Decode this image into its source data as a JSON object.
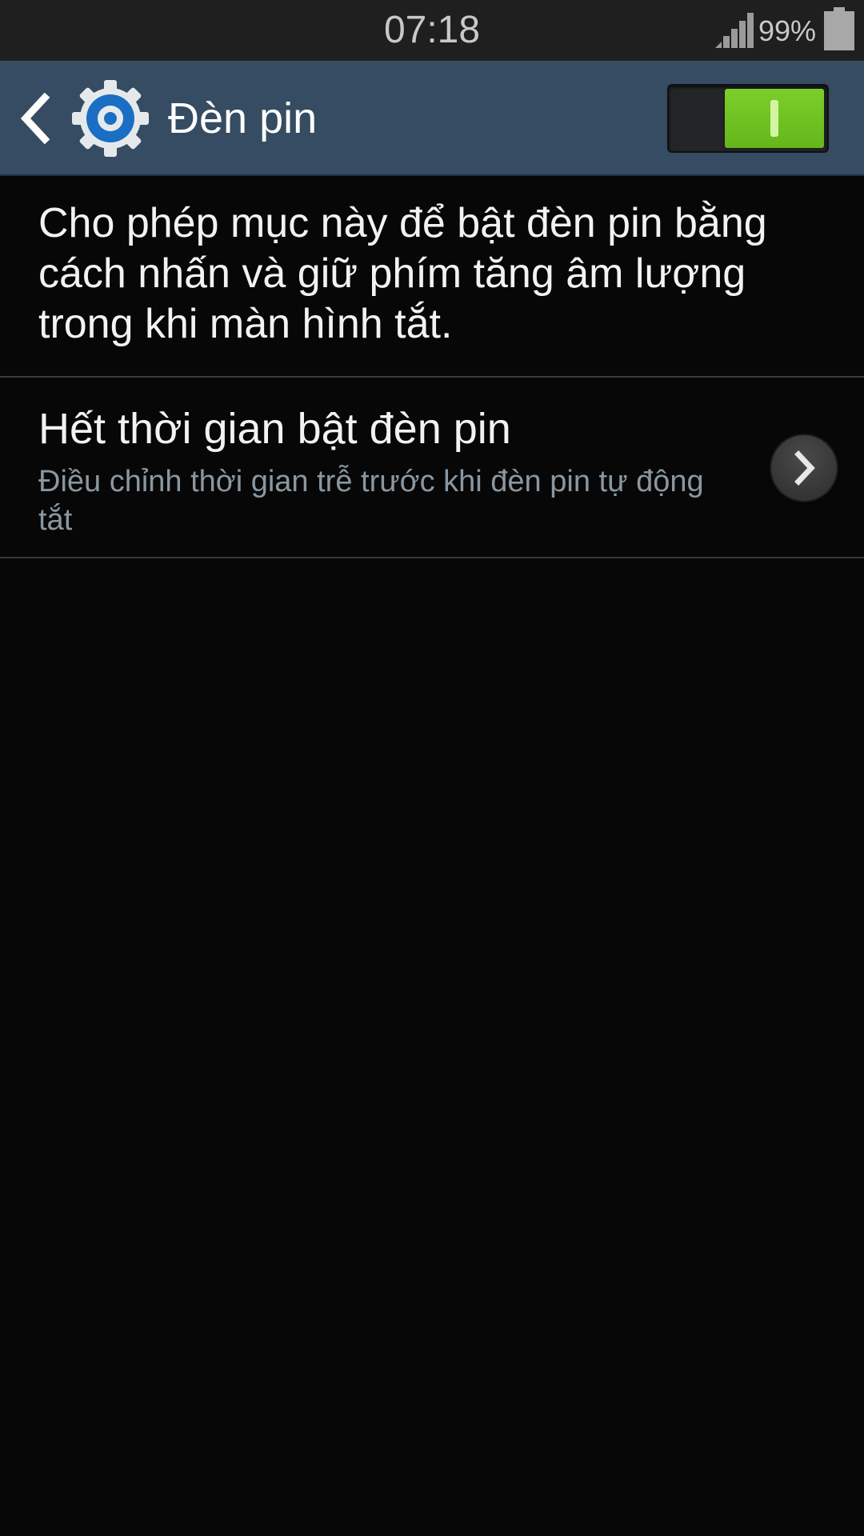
{
  "status_bar": {
    "time": "07:18",
    "battery_percent": "99%",
    "signal_icon": "signal-strength-icon",
    "battery_icon": "battery-icon"
  },
  "action_bar": {
    "back_icon": "chevron-left-icon",
    "app_icon": "settings-gear-icon",
    "title": "Đèn pin",
    "master_switch": {
      "state": "on",
      "accent_color": "#6ec222"
    }
  },
  "description": "Cho phép mục này để bật đèn pin bằng cách nhấn và giữ phím tăng âm lượng trong khi màn hình tắt.",
  "settings": [
    {
      "title": "Hết thời gian bật đèn pin",
      "subtitle": "Điều chỉnh thời gian trễ trước khi đèn pin tự động tắt",
      "action_icon": "chevron-right-icon"
    }
  ],
  "colors": {
    "status_bar_bg": "#1f1f1f",
    "action_bar_bg": "#354c62",
    "background": "#070707",
    "switch_on": "#6ec222"
  }
}
